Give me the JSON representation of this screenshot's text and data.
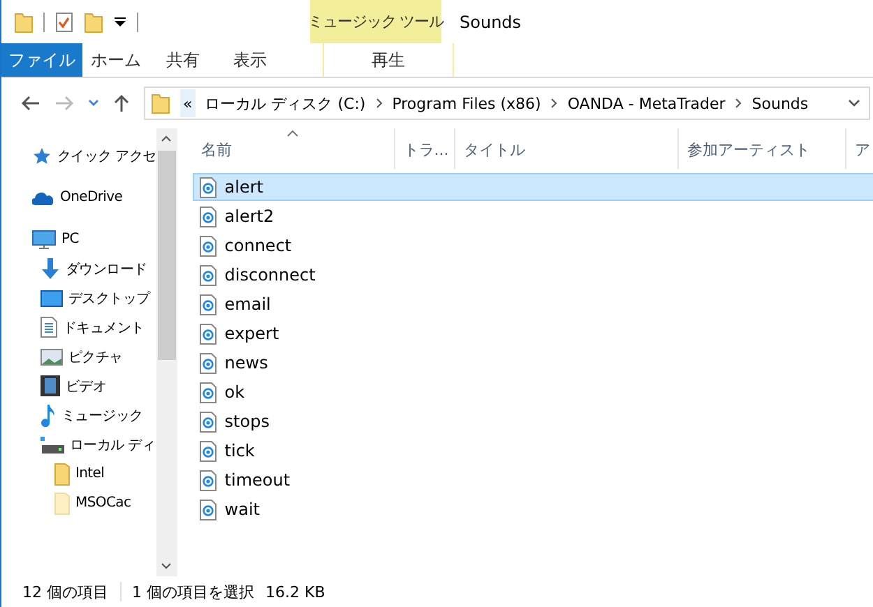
{
  "window": {
    "title": "Sounds"
  },
  "ribbon": {
    "context_label": "ミュージック ツール",
    "tabs": [
      {
        "label": "ファイル",
        "kind": "file",
        "selected": false
      },
      {
        "label": "ホーム",
        "kind": "normal",
        "selected": false
      },
      {
        "label": "共有",
        "kind": "normal",
        "selected": false
      },
      {
        "label": "表示",
        "kind": "normal",
        "selected": false
      },
      {
        "label": "再生",
        "kind": "context",
        "selected": false
      }
    ]
  },
  "address_bar": {
    "overflow": "«",
    "crumbs": [
      "ローカル ディスク (C:)",
      "Program Files (x86)",
      "OANDA - MetaTrader",
      "Sounds"
    ]
  },
  "sidebar": {
    "items": [
      {
        "label": "クイック アクセ",
        "kind": "star"
      },
      {
        "label": "OneDrive",
        "kind": "cloud"
      },
      {
        "label": "PC",
        "kind": "pc",
        "children": [
          {
            "label": "ダウンロード",
            "kind": "download"
          },
          {
            "label": "デスクトップ",
            "kind": "desktop"
          },
          {
            "label": "ドキュメント",
            "kind": "document"
          },
          {
            "label": "ピクチャ",
            "kind": "pictures"
          },
          {
            "label": "ビデオ",
            "kind": "video"
          },
          {
            "label": "ミュージック",
            "kind": "music"
          },
          {
            "label": "ローカル ディ",
            "kind": "drive",
            "children": [
              {
                "label": "Intel",
                "kind": "folder"
              },
              {
                "label": "MSOCac",
                "kind": "folder-faded"
              }
            ]
          }
        ]
      }
    ]
  },
  "table": {
    "columns": [
      "名前",
      "トラ...",
      "タイトル",
      "参加アーティスト",
      "ア"
    ],
    "rows": [
      {
        "name": "alert",
        "selected": true
      },
      {
        "name": "alert2",
        "selected": false
      },
      {
        "name": "connect",
        "selected": false
      },
      {
        "name": "disconnect",
        "selected": false
      },
      {
        "name": "email",
        "selected": false
      },
      {
        "name": "expert",
        "selected": false
      },
      {
        "name": "news",
        "selected": false
      },
      {
        "name": "ok",
        "selected": false
      },
      {
        "name": "stops",
        "selected": false
      },
      {
        "name": "tick",
        "selected": false
      },
      {
        "name": "timeout",
        "selected": false
      },
      {
        "name": "wait",
        "selected": false
      }
    ]
  },
  "status_bar": {
    "count": "12 個の項目",
    "selection": "1 個の項目を選択",
    "size": "16.2 KB"
  }
}
